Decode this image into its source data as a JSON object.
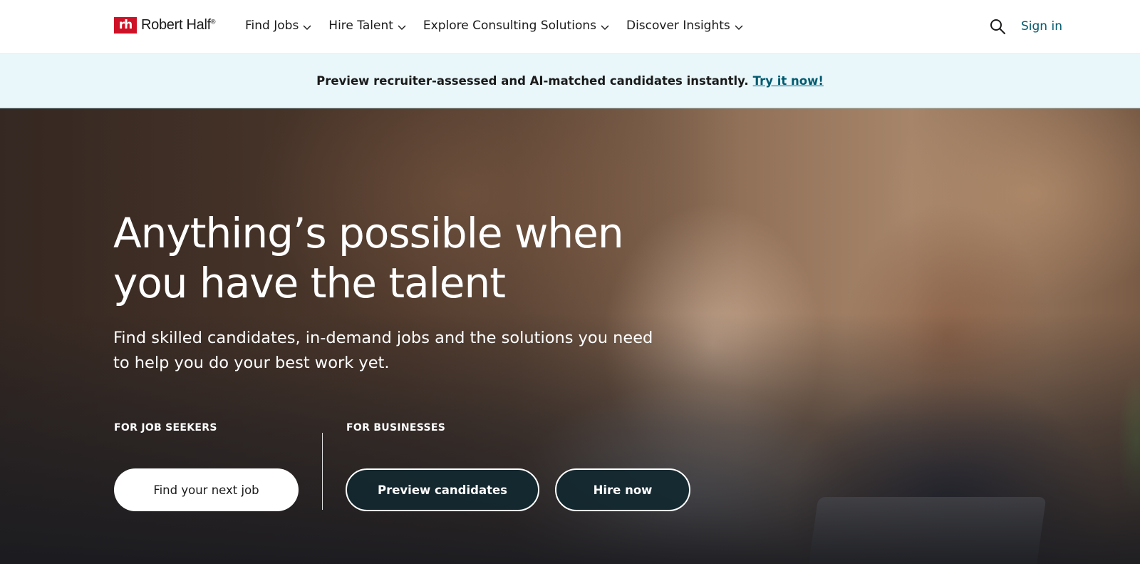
{
  "header": {
    "logo_mark": "rh",
    "logo_text": "Robert Half",
    "logo_trademark": "®",
    "nav": [
      {
        "label": "Find Jobs",
        "icon": "chevron-down-icon"
      },
      {
        "label": "Hire Talent",
        "icon": "chevron-down-icon"
      },
      {
        "label": "Explore Consulting Solutions",
        "icon": "chevron-down-icon"
      },
      {
        "label": "Discover Insights",
        "icon": "chevron-down-icon"
      }
    ],
    "search_icon": "search-icon",
    "sign_in_label": "Sign in"
  },
  "promo": {
    "text": "Preview recruiter-assessed and AI-matched candidates instantly.",
    "link_label": "Try it now!"
  },
  "hero": {
    "title": "Anything’s possible when you have the talent",
    "subtitle": "Find skilled candidates, in-demand jobs and the solutions you need to help you do your best work yet.",
    "job_seekers": {
      "label": "FOR JOB SEEKERS",
      "button_label": "Find your next job"
    },
    "businesses": {
      "label": "FOR BUSINESSES",
      "preview_button_label": "Preview candidates",
      "hire_button_label": "Hire now"
    }
  },
  "colors": {
    "brand_red": "#ce1126",
    "link_teal": "#005a6f",
    "banner_bg": "#e9f7fb",
    "dark_button": "#122830"
  }
}
